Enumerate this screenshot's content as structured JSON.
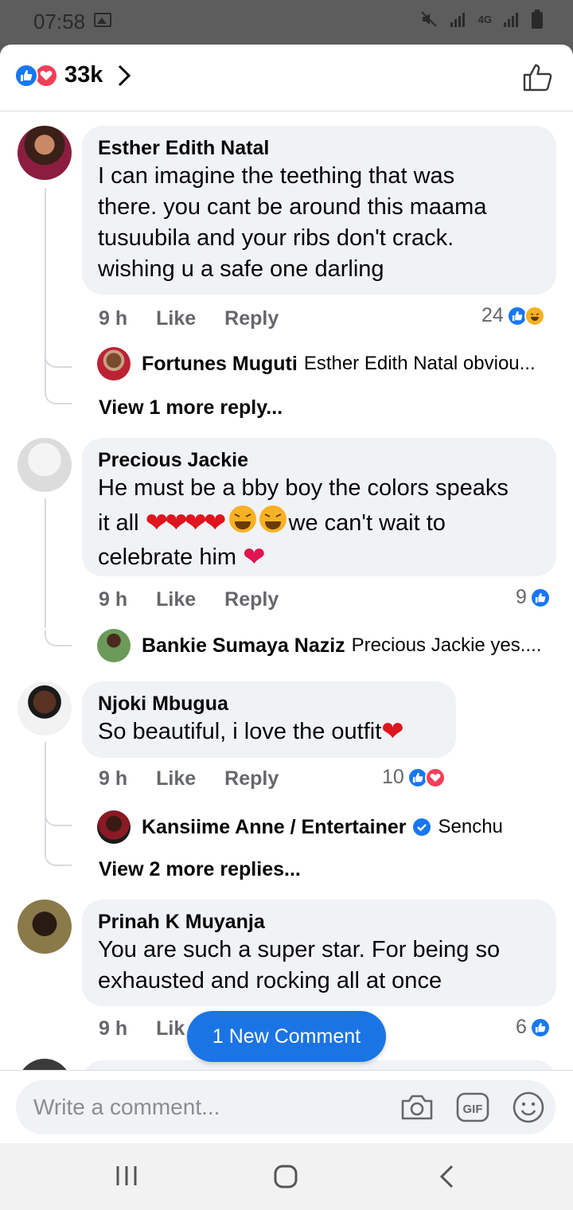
{
  "status_bar": {
    "time": "07:58",
    "network": "4G"
  },
  "header": {
    "reaction_count": "33k"
  },
  "comments": [
    {
      "author": "Esther Edith Natal",
      "text_lines": [
        "I can imagine the teething that was",
        "there. you cant be around this maama",
        "tusuubila and your ribs don't crack.",
        "wishing u a safe one darling"
      ],
      "time": "9 h",
      "like_label": "Like",
      "reply_label": "Reply",
      "reaction_count": "24",
      "reply": {
        "author": "Fortunes Muguti",
        "text": "Esther Edith Natal obviou..."
      },
      "more_replies": "View 1 more reply..."
    },
    {
      "author": "Precious Jackie",
      "text_lines": [
        "He must be a bby boy the colors speaks",
        "it all",
        "we can't wait to",
        "celebrate him"
      ],
      "time": "9 h",
      "like_label": "Like",
      "reply_label": "Reply",
      "reaction_count": "9",
      "reply": {
        "author": "Bankie Sumaya Naziz",
        "text": "Precious Jackie yes...."
      }
    },
    {
      "author": "Njoki Mbugua",
      "text_lines": [
        "So beautiful, i love the outfit"
      ],
      "time": "9 h",
      "like_label": "Like",
      "reply_label": "Reply",
      "reaction_count": "10",
      "reply": {
        "author": "Kansiime Anne / Entertainer",
        "text": "Senchu"
      },
      "more_replies": "View 2 more replies..."
    },
    {
      "author": "Prinah K Muyanja",
      "text_lines": [
        "You are such a super star. For being so",
        "exhausted and rocking all at once"
      ],
      "time": "9 h",
      "like_label": "Lik",
      "reaction_count": "6"
    }
  ],
  "new_comment_pill": "1 New Comment",
  "composer": {
    "placeholder": "Write a comment..."
  },
  "colors": {
    "accent": "#1877f2",
    "love": "#f33e58",
    "bubble": "#f0f2f5",
    "meta": "#65676b"
  },
  "icons": [
    "like-icon",
    "love-icon",
    "haha-icon",
    "chevron-right-icon",
    "thumbs-up-icon",
    "camera-icon",
    "gif-icon",
    "emoji-icon",
    "verified-icon"
  ]
}
